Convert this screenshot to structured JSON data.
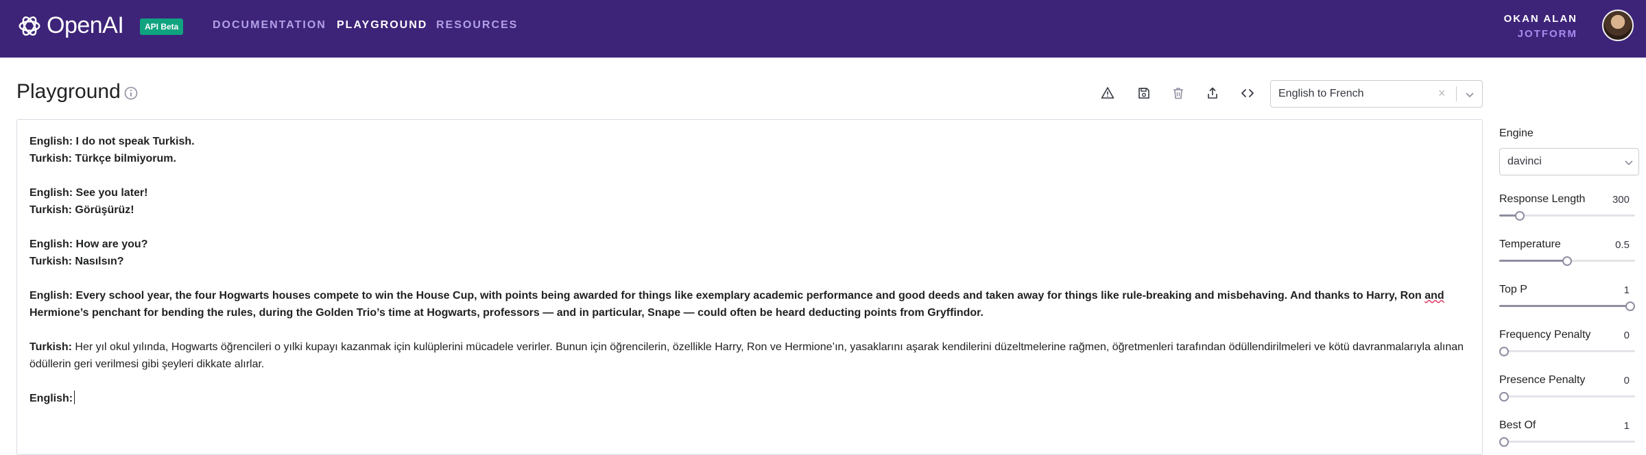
{
  "header": {
    "logo_text": "OpenAI",
    "badge": "API Beta",
    "nav": [
      {
        "label": "DOCUMENTATION",
        "active": false
      },
      {
        "label": "PLAYGROUND",
        "active": true
      },
      {
        "label": "RESOURCES",
        "active": false
      }
    ],
    "user_name": "OKAN ALAN",
    "user_org": "JOTFORM"
  },
  "page": {
    "title": "Playground"
  },
  "toolbar": {
    "icons": [
      "warning-icon",
      "save-icon",
      "trash-icon",
      "share-icon",
      "code-icon"
    ],
    "preset_value": "English to French"
  },
  "editor": {
    "blocks": [
      {
        "lines": [
          {
            "label": "English:",
            "text": " I do not speak Turkish.",
            "bold": true
          },
          {
            "label": "Turkish:",
            "text": " Türkçe bilmiyorum.",
            "bold": true
          }
        ]
      },
      {
        "lines": [
          {
            "label": "English:",
            "text": " See you later!",
            "bold": true
          },
          {
            "label": "Turkish:",
            "text": " Görüşürüz!",
            "bold": true
          }
        ]
      },
      {
        "lines": [
          {
            "label": "English:",
            "text": " How are you?",
            "bold": true
          },
          {
            "label": "Turkish:",
            "text": " Nasılsın?",
            "bold": true
          }
        ]
      },
      {
        "lines": [
          {
            "label": "English:",
            "text": " Every school year, the four Hogwarts houses compete to win the House Cup, with points being awarded for things like exemplary academic performance and good deeds and taken away for things like rule-breaking and misbehaving. And thanks to Harry, Ron and Hermione’s penchant for bending the rules, during the Golden Trio’s time at Hogwarts, professors — and in particular, Snape — could often be heard deducting points from Gryffindor.",
            "bold": true
          }
        ]
      },
      {
        "lines": [
          {
            "label": "Turkish:",
            "text": " Her yıl okul yılında, Hogwarts öğrencileri o yılki kupayı kazanmak için kulüplerini mücadele verirler. Bunun için öğrencilerin, özellikle Harry, Ron ve Hermione’ın, yasaklarını aşarak kendilerini düzeltmelerine rağmen, öğretmenleri tarafından ödüllendirilmeleri ve kötü davranmalarıyla alınan ödüllerin geri verilmesi gibi şeyleri dikkate alırlar.",
            "bold": false
          }
        ]
      },
      {
        "lines": [
          {
            "label": "English:",
            "text": "",
            "bold": false,
            "cursor": true
          }
        ]
      }
    ]
  },
  "settings": {
    "engine_label": "Engine",
    "engine_value": "davinci",
    "params": [
      {
        "label": "Response Length",
        "value": "300",
        "level": 0.15
      },
      {
        "label": "Temperature",
        "value": "0.5",
        "level": 0.5
      },
      {
        "label": "Top P",
        "value": "1",
        "level": 1.0
      },
      {
        "label": "Frequency Penalty",
        "value": "0",
        "level": 0.0
      },
      {
        "label": "Presence Penalty",
        "value": "0",
        "level": 0.0
      },
      {
        "label": "Best Of",
        "value": "1",
        "level": 0.0
      }
    ]
  }
}
